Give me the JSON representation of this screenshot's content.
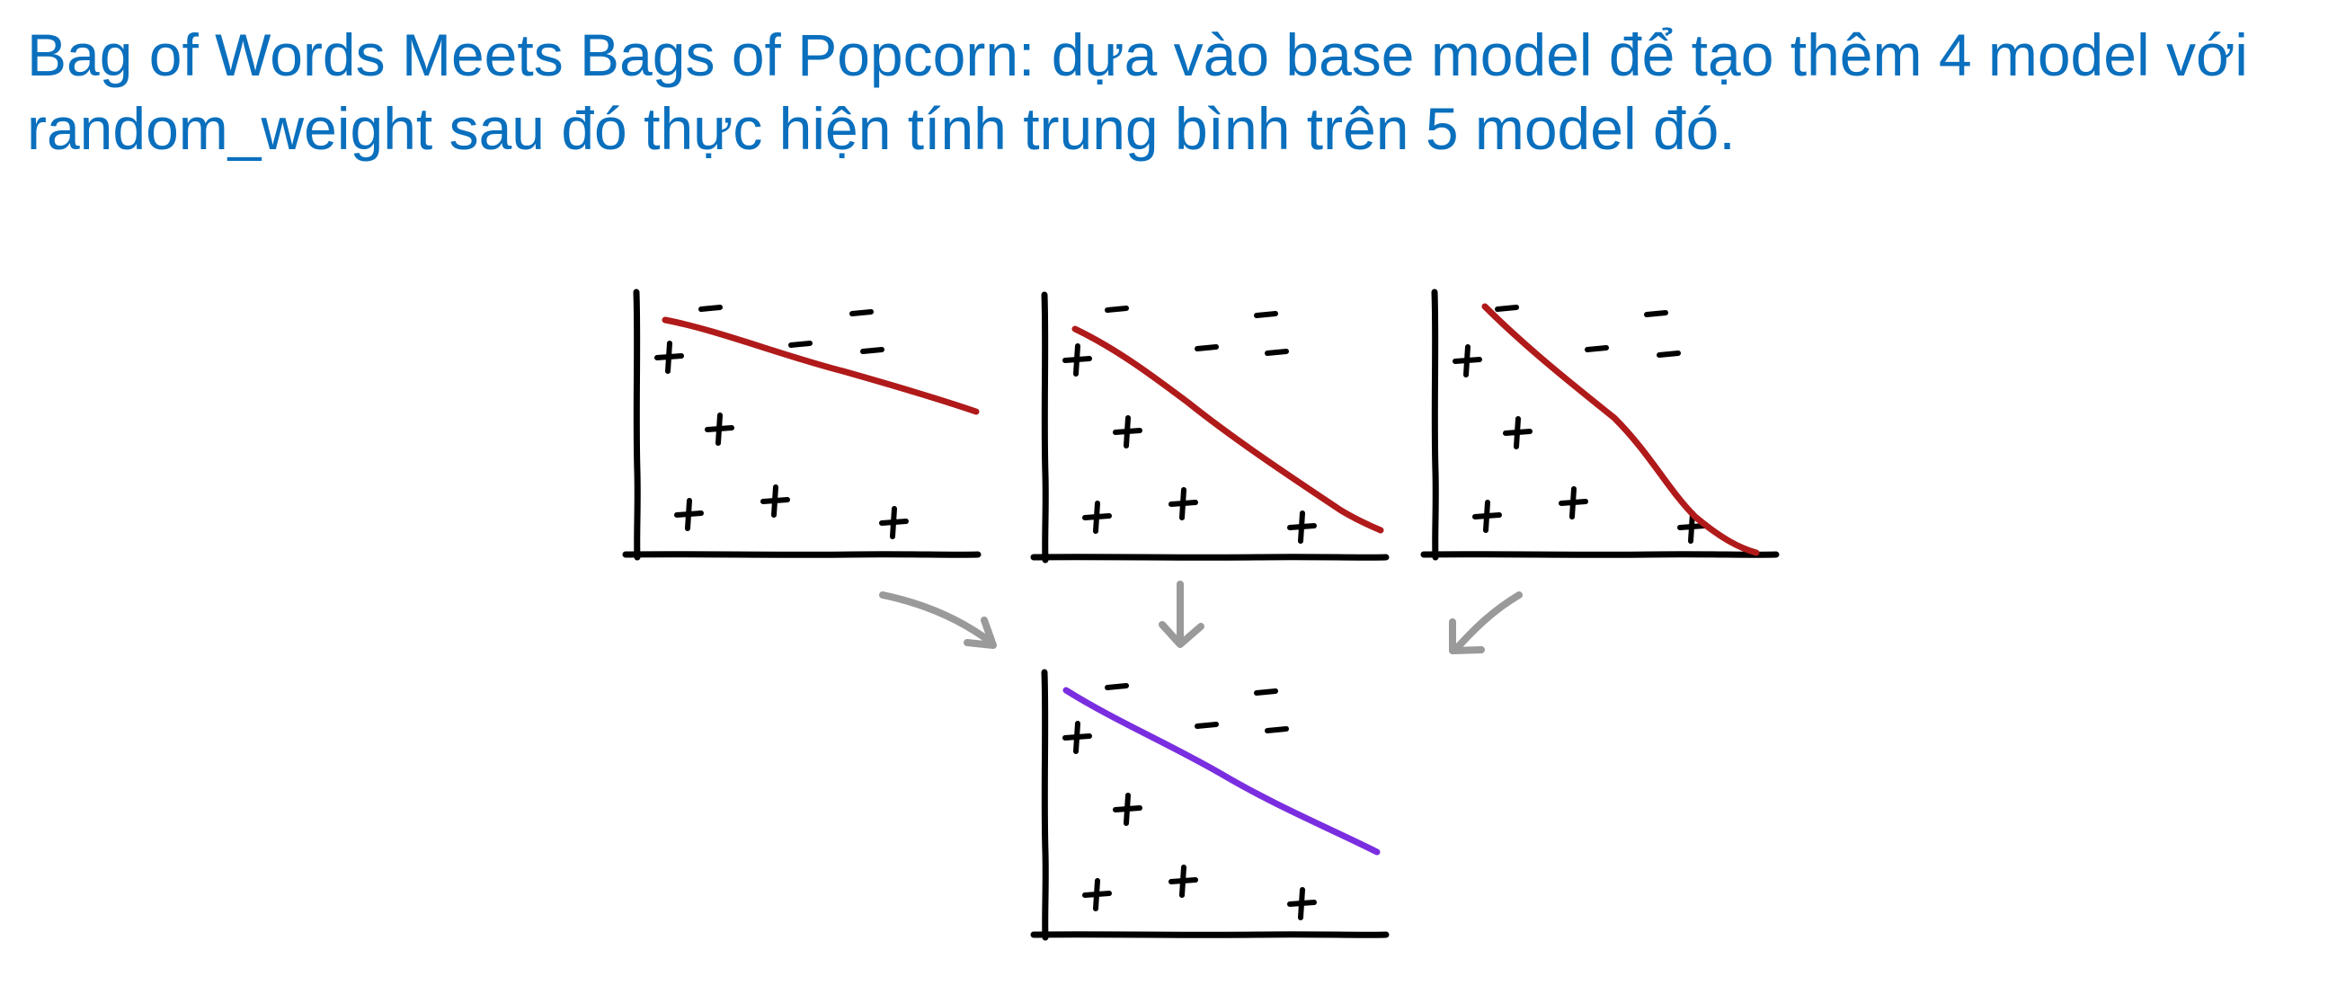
{
  "slide": {
    "title": "Bag of Words Meets Bags of Popcorn: dựa vào base model để tạo thêm 4 model với random_weight sau đó thực hiện tính trung bình trên 5 model đó."
  },
  "diagram": {
    "panel_count": 4,
    "colors": {
      "axis": "#000000",
      "base_model_line": "#b01a1a",
      "averaged_model_line": "#7a2ee0",
      "arrow": "#9a9a9a"
    },
    "icons": [
      "plus-icon",
      "minus-icon",
      "arrow-icon"
    ]
  }
}
